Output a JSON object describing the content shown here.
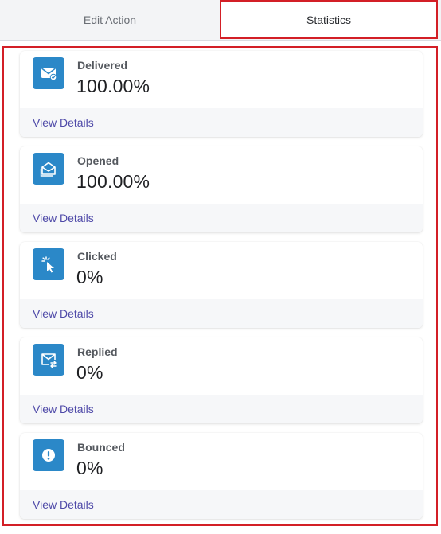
{
  "tabs": [
    {
      "label": "Edit Action",
      "active": false
    },
    {
      "label": "Statistics",
      "active": true
    }
  ],
  "colors": {
    "accent_border": "#d31f26",
    "icon_bg": "#2b88c8",
    "link": "#4e49a8"
  },
  "stats": [
    {
      "icon": "mail-check-icon",
      "label": "Delivered",
      "value": "100.00%",
      "link": "View Details"
    },
    {
      "icon": "mail-open-icon",
      "label": "Opened",
      "value": "100.00%",
      "link": "View Details"
    },
    {
      "icon": "cursor-click-icon",
      "label": "Clicked",
      "value": "0%",
      "link": "View Details"
    },
    {
      "icon": "mail-reply-icon",
      "label": "Replied",
      "value": "0%",
      "link": "View Details"
    },
    {
      "icon": "alert-circle-icon",
      "label": "Bounced",
      "value": "0%",
      "link": "View Details"
    }
  ]
}
